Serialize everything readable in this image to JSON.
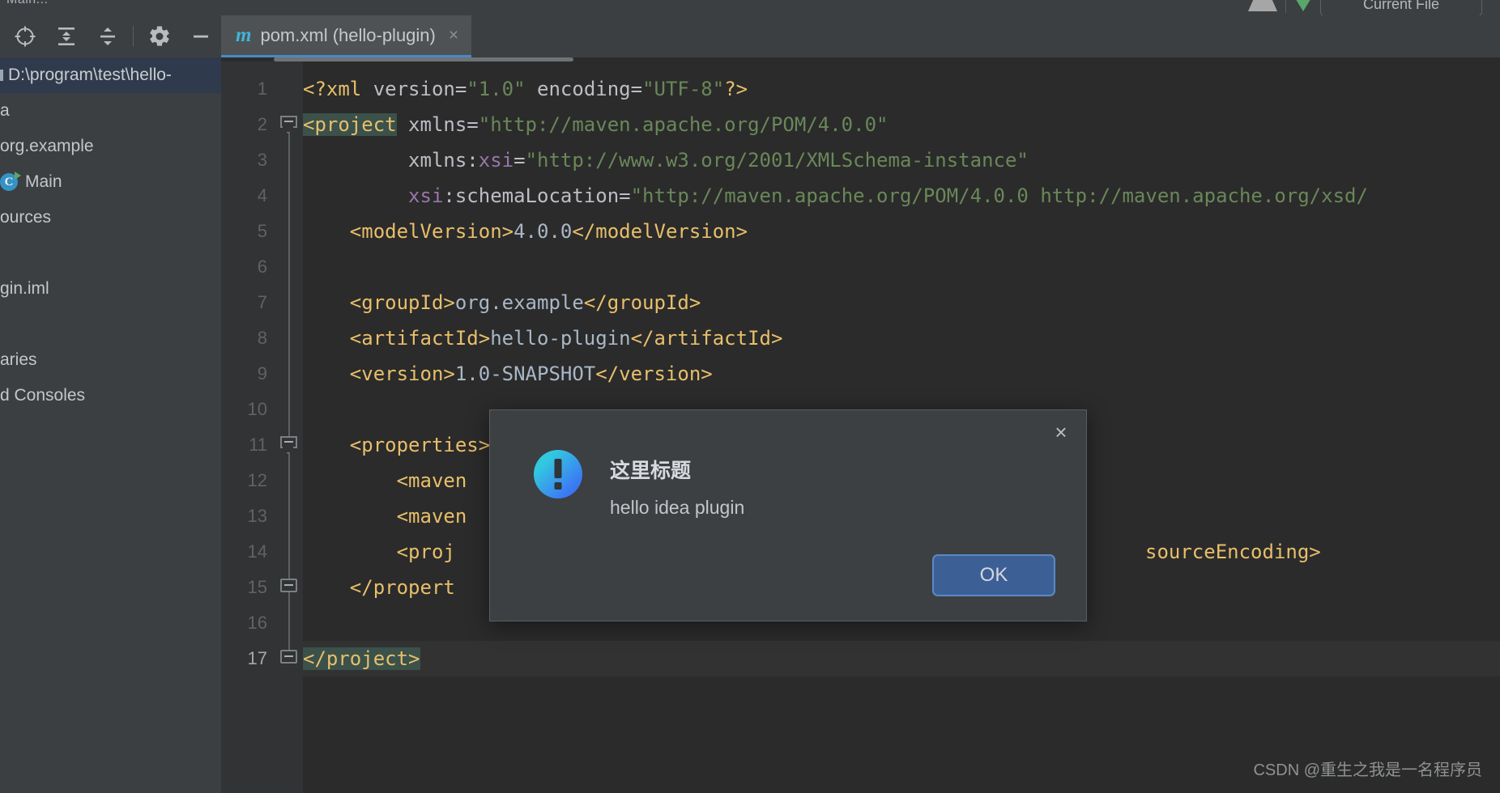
{
  "window": {
    "menu_ghost": "Main..."
  },
  "top_right": {
    "run_config_label": "Current File",
    "run_icon": "run-triangle-icon",
    "sep": "separator"
  },
  "project_panel": {
    "toolbar": [
      {
        "name": "select-opened-file-icon",
        "label": "Select Opened File"
      },
      {
        "name": "expand-all-icon",
        "label": "Expand All"
      },
      {
        "name": "collapse-all-icon",
        "label": "Collapse All"
      },
      {
        "name": "settings-gear-icon",
        "label": "Settings"
      },
      {
        "name": "hide-panel-icon",
        "label": "Hide"
      }
    ],
    "selected_path": "D:\\program\\test\\hello-",
    "tree": [
      {
        "label": "a",
        "icon": null
      },
      {
        "label": "org.example",
        "icon": null
      },
      {
        "label": "Main",
        "icon": "java-class-run-icon"
      },
      {
        "label": "ources",
        "icon": null
      },
      {
        "label": "",
        "icon": null
      },
      {
        "label": "gin.iml",
        "icon": null
      },
      {
        "label": "",
        "icon": null
      },
      {
        "label": "aries",
        "icon": null
      },
      {
        "label": "d Consoles",
        "icon": null
      }
    ]
  },
  "editor": {
    "tab": {
      "icon": "maven-m-icon",
      "icon_glyph": "m",
      "title": "pom.xml (hello-plugin)",
      "close_glyph": "×"
    },
    "current_line": 17,
    "line_numbers": [
      1,
      2,
      3,
      4,
      5,
      6,
      7,
      8,
      9,
      10,
      11,
      12,
      13,
      14,
      15,
      16,
      17
    ],
    "fold_markers": [
      {
        "line": 2,
        "type": "collapse-down"
      },
      {
        "line": 11,
        "type": "collapse-down"
      },
      {
        "line": 15,
        "type": "collapse-up"
      },
      {
        "line": 17,
        "type": "collapse-up"
      }
    ],
    "lines": [
      {
        "n": 1,
        "segments": [
          {
            "t": "<?xml ",
            "c": "tk-tag"
          },
          {
            "t": "version",
            "c": "tk-attr"
          },
          {
            "t": "=",
            "c": "tk-eq"
          },
          {
            "t": "\"1.0\"",
            "c": "tk-val"
          },
          {
            "t": " ",
            "c": "tk-txt"
          },
          {
            "t": "encoding",
            "c": "tk-attr"
          },
          {
            "t": "=",
            "c": "tk-eq"
          },
          {
            "t": "\"UTF-8\"",
            "c": "tk-val"
          },
          {
            "t": "?>",
            "c": "tk-tag"
          }
        ]
      },
      {
        "n": 2,
        "segments": [
          {
            "t": "<project",
            "c": "tk-tag hl-brace"
          },
          {
            "t": " ",
            "c": "tk-txt"
          },
          {
            "t": "xmlns",
            "c": "tk-attr"
          },
          {
            "t": "=",
            "c": "tk-eq"
          },
          {
            "t": "\"http://maven.apache.org/POM/4.0.0\"",
            "c": "tk-val"
          }
        ]
      },
      {
        "n": 3,
        "segments": [
          {
            "t": "         ",
            "c": "tk-txt"
          },
          {
            "t": "xmlns:",
            "c": "tk-attr"
          },
          {
            "t": "xsi",
            "c": "tk-ns"
          },
          {
            "t": "=",
            "c": "tk-eq"
          },
          {
            "t": "\"http://www.w3.org/2001/XMLSchema-instance\"",
            "c": "tk-val"
          }
        ]
      },
      {
        "n": 4,
        "segments": [
          {
            "t": "         ",
            "c": "tk-txt"
          },
          {
            "t": "xsi",
            "c": "tk-ns"
          },
          {
            "t": ":schemaLocation",
            "c": "tk-attr"
          },
          {
            "t": "=",
            "c": "tk-eq"
          },
          {
            "t": "\"http://maven.apache.org/POM/4.0.0 http://maven.apache.org/xsd/",
            "c": "tk-val"
          }
        ]
      },
      {
        "n": 5,
        "segments": [
          {
            "t": "    ",
            "c": "tk-txt"
          },
          {
            "t": "<modelVersion>",
            "c": "tk-tag"
          },
          {
            "t": "4.0.0",
            "c": "tk-txt"
          },
          {
            "t": "</modelVersion>",
            "c": "tk-tag"
          }
        ]
      },
      {
        "n": 6,
        "segments": []
      },
      {
        "n": 7,
        "segments": [
          {
            "t": "    ",
            "c": "tk-txt"
          },
          {
            "t": "<groupId>",
            "c": "tk-tag"
          },
          {
            "t": "org.example",
            "c": "tk-txt"
          },
          {
            "t": "</groupId>",
            "c": "tk-tag"
          }
        ]
      },
      {
        "n": 8,
        "segments": [
          {
            "t": "    ",
            "c": "tk-txt"
          },
          {
            "t": "<artifactId>",
            "c": "tk-tag"
          },
          {
            "t": "hello-plugin",
            "c": "tk-txt"
          },
          {
            "t": "</artifactId>",
            "c": "tk-tag"
          }
        ]
      },
      {
        "n": 9,
        "segments": [
          {
            "t": "    ",
            "c": "tk-txt"
          },
          {
            "t": "<version>",
            "c": "tk-tag"
          },
          {
            "t": "1.0-SNAPSHOT",
            "c": "tk-txt"
          },
          {
            "t": "</version>",
            "c": "tk-tag"
          }
        ]
      },
      {
        "n": 10,
        "segments": []
      },
      {
        "n": 11,
        "segments": [
          {
            "t": "    ",
            "c": "tk-txt"
          },
          {
            "t": "<properties>",
            "c": "tk-tag"
          }
        ]
      },
      {
        "n": 12,
        "segments": [
          {
            "t": "        ",
            "c": "tk-txt"
          },
          {
            "t": "<maven",
            "c": "tk-tag"
          }
        ]
      },
      {
        "n": 13,
        "segments": [
          {
            "t": "        ",
            "c": "tk-txt"
          },
          {
            "t": "<maven",
            "c": "tk-tag"
          }
        ]
      },
      {
        "n": 14,
        "segments": [
          {
            "t": "        ",
            "c": "tk-txt"
          },
          {
            "t": "<proj",
            "c": "tk-tag"
          }
        ]
      },
      {
        "n": 15,
        "segments": [
          {
            "t": "    ",
            "c": "tk-txt"
          },
          {
            "t": "</propert",
            "c": "tk-tag"
          }
        ]
      },
      {
        "n": 16,
        "segments": []
      },
      {
        "n": 17,
        "segments": [
          {
            "t": "</project>",
            "c": "tk-tag hl-brace"
          }
        ]
      }
    ],
    "line14_tail": "sourceEncoding>"
  },
  "dialog": {
    "icon": "info-exclamation-icon",
    "title": "这里标题",
    "message": "hello idea plugin",
    "ok_label": "OK",
    "close_glyph": "×"
  },
  "watermark": {
    "text": "CSDN @重生之我是一名程序员"
  },
  "colors": {
    "editor_bg": "#2b2b2b",
    "panel_bg": "#3c3f41",
    "gutter_bg": "#313335",
    "tab_active_bg": "#4e5254",
    "tab_underline": "#4a88c7",
    "selection_blue": "#2f3b4d",
    "tag_orange": "#e8bf6a",
    "value_green": "#6a8759",
    "ns_purple": "#9876aa",
    "brace_match": "#3b514a",
    "dialog_bg": "#3c4043",
    "button_blue": "#3c6096",
    "run_green": "#59a869",
    "maven_cyan": "#3fb4d8"
  }
}
